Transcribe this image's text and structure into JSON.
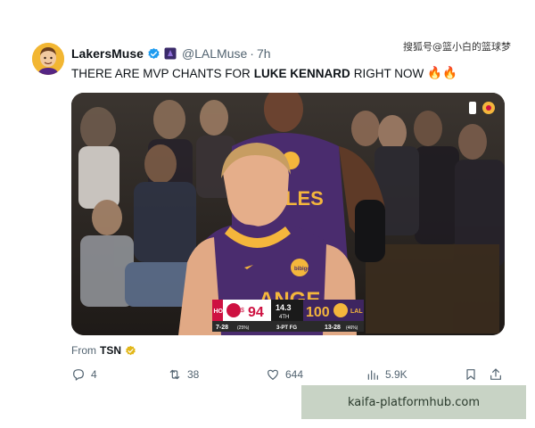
{
  "post": {
    "author_name": "LakersMuse",
    "handle": "@LALMuse",
    "separator": "·",
    "time": "7h",
    "text_before": "THERE ARE MVP CHANTS FOR",
    "text_bold": "LUKE KENNARD",
    "text_after": "RIGHT NOW",
    "emoji": "🔥🔥",
    "source_prefix": "From",
    "source_name": "TSN"
  },
  "scoreboard": {
    "away_team": "HOU",
    "away_score": "94",
    "away_fouls_mark": "$",
    "clock": "14.3",
    "period": "4TH",
    "home_score": "100",
    "home_team": "LAL",
    "away_record": "7-28",
    "away_pct": "(25%)",
    "stat_label": "3-PT FG",
    "home_record": "13-28",
    "home_pct": "(46%)"
  },
  "jersey": {
    "front_text": "ANGE",
    "back_text": "LES",
    "patch_text": "bibigo"
  },
  "actions": {
    "replies": "4",
    "reposts": "38",
    "likes": "644",
    "views": "5.9K"
  },
  "overlays": {
    "top_watermark": "搜狐号@篮小白的篮球梦",
    "site_badge": "kaifa-platformhub.com"
  },
  "colors": {
    "verified": "#1d9bf0",
    "lakers_purple": "#4a2c6e",
    "lakers_gold": "#f4b63c",
    "rockets_red": "#ce1141"
  }
}
